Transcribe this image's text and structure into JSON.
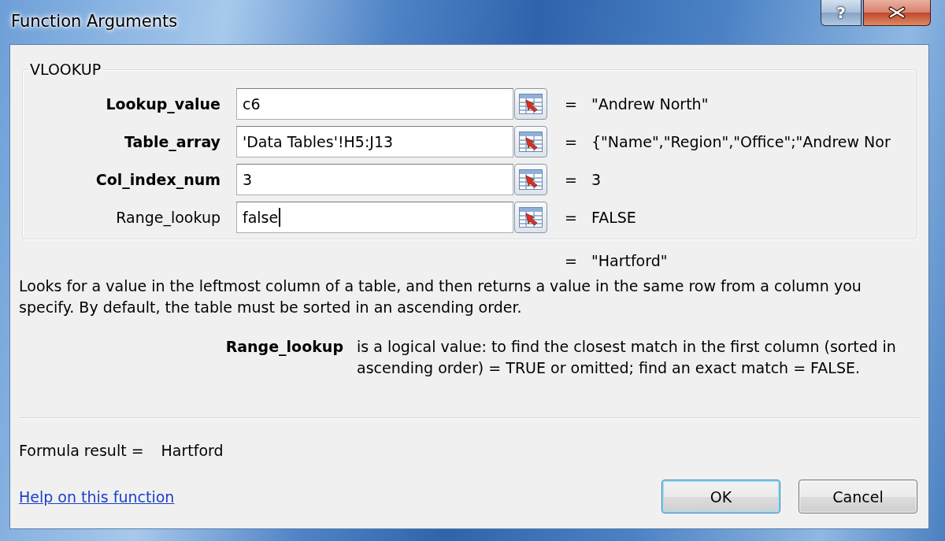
{
  "window": {
    "title": "Function Arguments",
    "help_button": "?"
  },
  "function": {
    "name": "VLOOKUP",
    "arguments": [
      {
        "name": "Lookup_value",
        "required": true,
        "value": "c6",
        "focused": false,
        "equals": "=",
        "evaluated": "\"Andrew North\""
      },
      {
        "name": "Table_array",
        "required": true,
        "value": "'Data Tables'!H5:J13",
        "focused": false,
        "equals": "=",
        "evaluated": "{\"Name\",\"Region\",\"Office\";\"Andrew Nor"
      },
      {
        "name": "Col_index_num",
        "required": true,
        "value": "3",
        "focused": false,
        "equals": "=",
        "evaluated": "3"
      },
      {
        "name": "Range_lookup",
        "required": false,
        "value": "false",
        "focused": true,
        "equals": "=",
        "evaluated": "FALSE"
      }
    ],
    "result": {
      "equals": "=",
      "value": "\"Hartford\""
    },
    "description": "Looks for a value in the leftmost column of a table, and then returns a value in the same row from a column you specify. By default, the table must be sorted in an ascending order.",
    "argument_help": {
      "name": "Range_lookup",
      "text": "is a logical value: to find the closest match in the first column (sorted in ascending order) = TRUE or omitted; find an exact match = FALSE."
    }
  },
  "formula_result": {
    "label": "Formula result =",
    "value": "Hartford"
  },
  "help_link": "Help on this function",
  "buttons": [
    {
      "label": "OK",
      "default": true
    },
    {
      "label": "Cancel",
      "default": false
    }
  ]
}
